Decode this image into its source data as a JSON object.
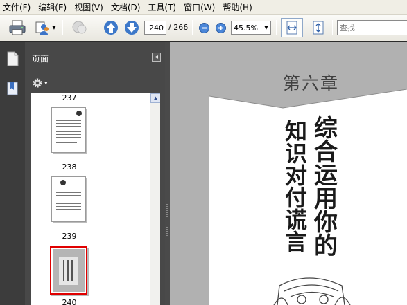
{
  "menu": [
    "文件(F)",
    "编辑(E)",
    "视图(V)",
    "文档(D)",
    "工具(T)",
    "窗口(W)",
    "帮助(H)"
  ],
  "toolbar": {
    "current_page": "240",
    "total_pages": "/ 266",
    "zoom": "45.5%",
    "search_placeholder": "查找"
  },
  "nav_panel": {
    "title": "页面",
    "thumbnails": [
      {
        "label": "237"
      },
      {
        "label": "238"
      },
      {
        "label": "239"
      },
      {
        "label": "240",
        "selected": true
      }
    ]
  },
  "document": {
    "chapter": "第六章",
    "title_col1": "知识对付谎言",
    "title_col2": "综合运用你的"
  },
  "colors": {
    "selection": "#e00000",
    "panel_bg": "#484848",
    "page_bg": "#b3b3b3"
  }
}
